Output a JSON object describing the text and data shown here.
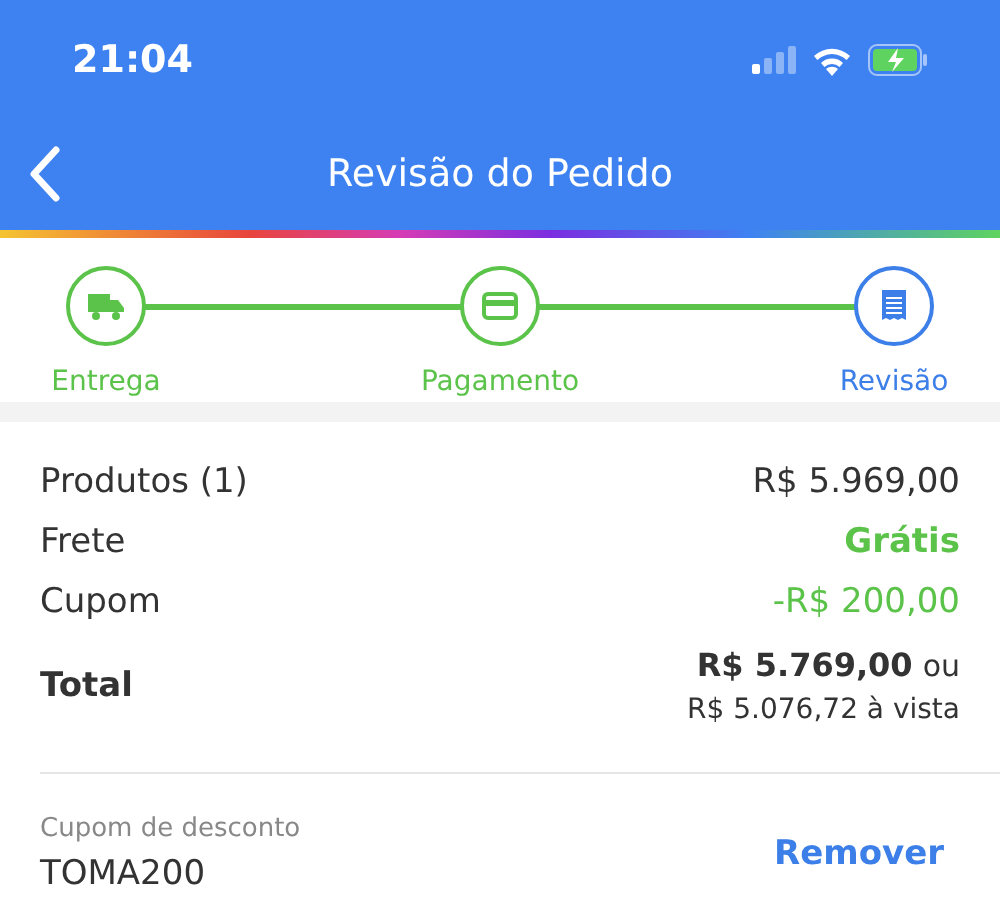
{
  "status_bar": {
    "time": "21:04"
  },
  "nav": {
    "title": "Revisão do Pedido"
  },
  "steps": [
    {
      "label": "Entrega",
      "completed": true
    },
    {
      "label": "Pagamento",
      "completed": true
    },
    {
      "label": "Revisão",
      "completed": false
    }
  ],
  "summary": [
    {
      "label": "Produtos (1)",
      "value": "R$ 5.969,00",
      "kind": "normal"
    },
    {
      "label": "Frete",
      "value": "Grátis",
      "kind": "positive_bold"
    },
    {
      "label": "Cupom",
      "value": "-R$ 200,00",
      "kind": "positive"
    }
  ],
  "total": {
    "label": "Total",
    "value": "R$ 5.769,00",
    "connector": "ou",
    "cash_price": "R$ 5.076,72 à vista"
  },
  "coupon": {
    "label": "Cupom de desconto",
    "code": "TOMA200",
    "action": "Remover"
  }
}
